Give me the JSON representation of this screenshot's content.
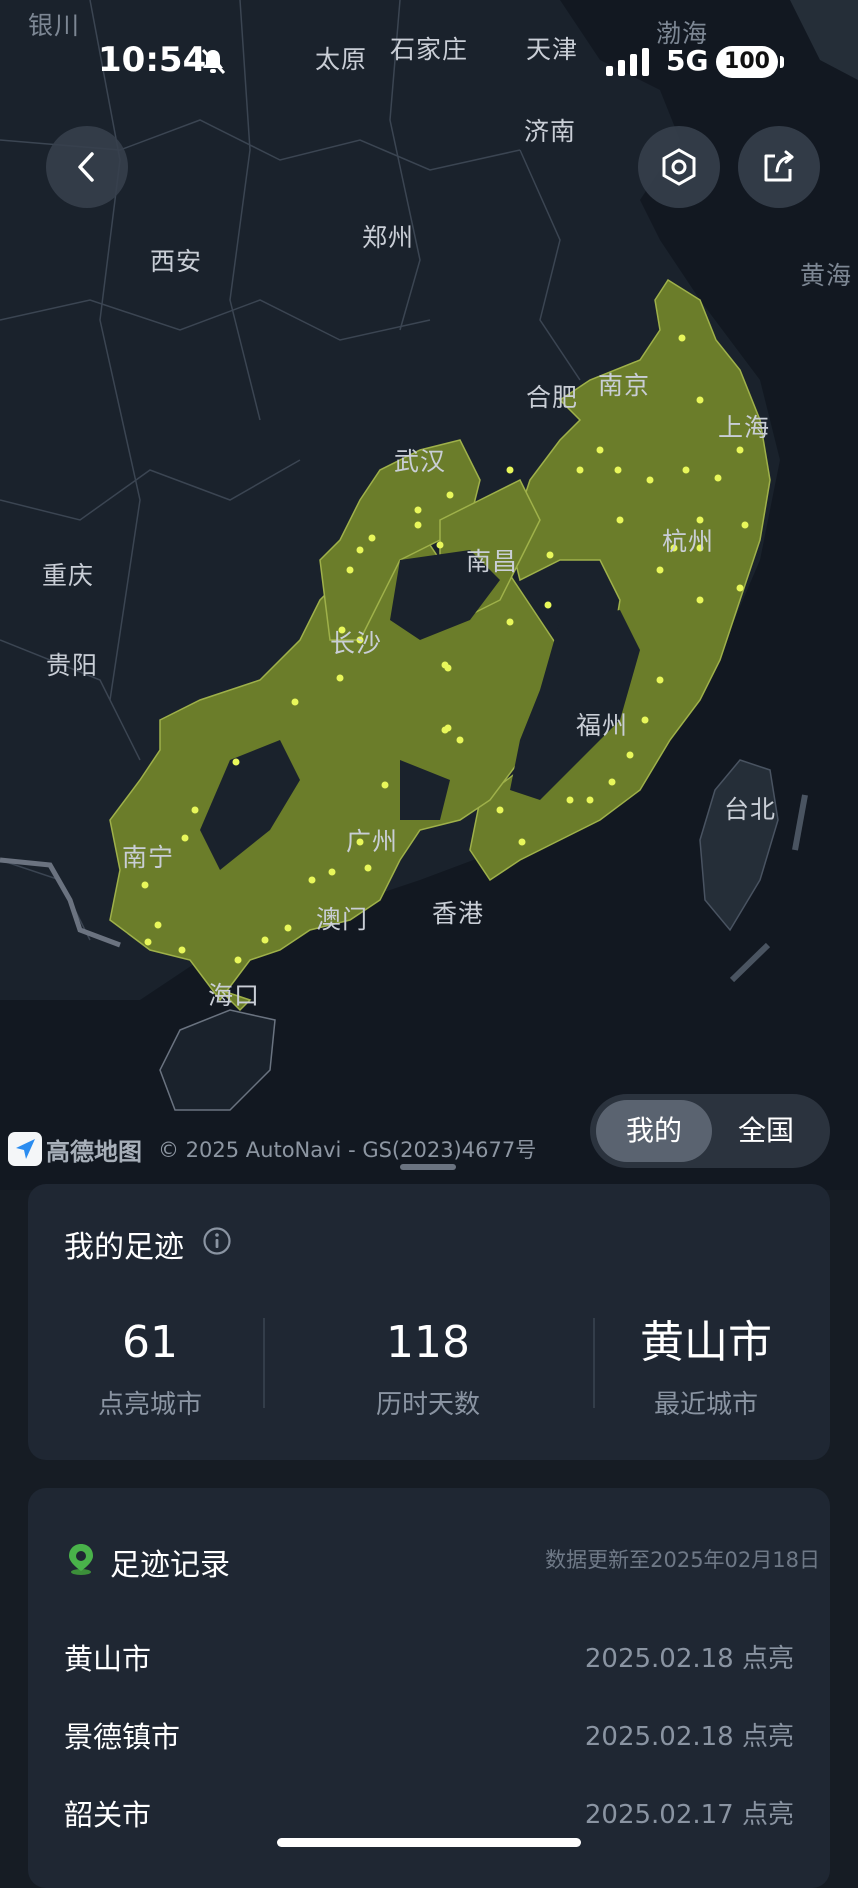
{
  "status_bar": {
    "time": "10:54",
    "network": "5G",
    "battery": "100"
  },
  "map": {
    "labels": [
      {
        "text": "银川",
        "cls": "dim"
      },
      {
        "text": "太原",
        "cls": ""
      },
      {
        "text": "石家庄",
        "cls": ""
      },
      {
        "text": "天津",
        "cls": ""
      },
      {
        "text": "渤海",
        "cls": "dim"
      },
      {
        "text": "济南",
        "cls": ""
      },
      {
        "text": "郑州",
        "cls": ""
      },
      {
        "text": "西安",
        "cls": ""
      },
      {
        "text": "黄海",
        "cls": "dim"
      },
      {
        "text": "合肥",
        "cls": ""
      },
      {
        "text": "南京",
        "cls": ""
      },
      {
        "text": "上海",
        "cls": ""
      },
      {
        "text": "武汉",
        "cls": ""
      },
      {
        "text": "南昌",
        "cls": ""
      },
      {
        "text": "杭州",
        "cls": ""
      },
      {
        "text": "重庆",
        "cls": ""
      },
      {
        "text": "长沙",
        "cls": ""
      },
      {
        "text": "贵阳",
        "cls": ""
      },
      {
        "text": "福州",
        "cls": ""
      },
      {
        "text": "台北",
        "cls": ""
      },
      {
        "text": "南宁",
        "cls": ""
      },
      {
        "text": "广州",
        "cls": ""
      },
      {
        "text": "澳门",
        "cls": ""
      },
      {
        "text": "香港",
        "cls": ""
      },
      {
        "text": "海口",
        "cls": ""
      }
    ],
    "highlight_color": "#6b7d2a",
    "dot_color": "#e8f75a",
    "attribution_logo": "高德地图",
    "attribution": "© 2025 AutoNavi - GS(2023)4677号"
  },
  "toggle": {
    "mine": "我的",
    "national": "全国",
    "selected": "我的"
  },
  "summary": {
    "title": "我的足迹",
    "stats": [
      {
        "value": "61",
        "label": "点亮城市"
      },
      {
        "value": "118",
        "label": "历时天数"
      },
      {
        "value": "黄山市",
        "label": "最近城市"
      }
    ]
  },
  "records": {
    "title": "足迹记录",
    "updated": "数据更新至2025年02月18日",
    "items": [
      {
        "city": "黄山市",
        "date": "2025.02.18 点亮"
      },
      {
        "city": "景德镇市",
        "date": "2025.02.18 点亮"
      },
      {
        "city": "韶关市",
        "date": "2025.02.17 点亮"
      }
    ]
  }
}
